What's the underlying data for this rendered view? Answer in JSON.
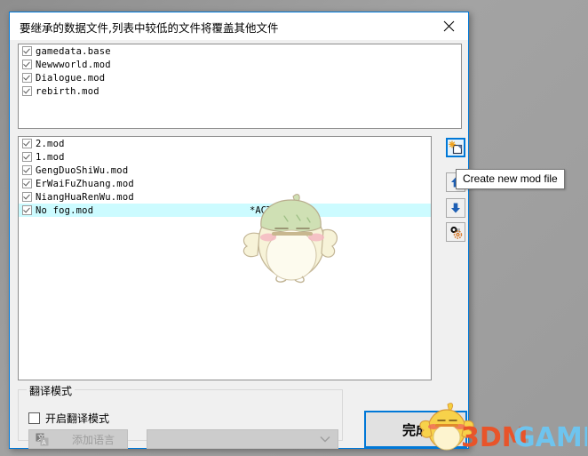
{
  "window": {
    "title": "要继承的数据文件,列表中较低的文件将覆盖其他文件",
    "close_label": "×",
    "close_icon": "close-icon"
  },
  "inherit_list": {
    "items": [
      {
        "label": "gamedata.base",
        "checked": true
      },
      {
        "label": "Newwworld.mod",
        "checked": true
      },
      {
        "label": "Dialogue.mod",
        "checked": true
      },
      {
        "label": "rebirth.mod",
        "checked": true
      }
    ]
  },
  "mod_list": {
    "active_tag": "*ACTIVE*",
    "items": [
      {
        "label": "2.mod",
        "checked": true,
        "active": false
      },
      {
        "label": "1.mod",
        "checked": true,
        "active": false
      },
      {
        "label": "GengDuoShiWu.mod",
        "checked": true,
        "active": false
      },
      {
        "label": "ErWaiFuZhuang.mod",
        "checked": true,
        "active": false
      },
      {
        "label": "NiangHuaRenWu.mod",
        "checked": true,
        "active": false
      },
      {
        "label": "No fog.mod",
        "checked": true,
        "active": true
      }
    ]
  },
  "toolbar": {
    "new_mod_icon": "new-file-icon",
    "move_up_icon": "arrow-up-icon",
    "move_down_icon": "arrow-down-icon",
    "settings_icon": "gear-icon"
  },
  "tooltip": {
    "text": "Create new mod file"
  },
  "translation_group": {
    "legend": "翻译模式",
    "checkbox_label": "开启翻译模式",
    "checkbox_checked": false,
    "add_language_label": "添加语言",
    "add_language_icon": "language-icon",
    "add_language_enabled": false,
    "language_select_value": "",
    "language_select_enabled": false,
    "dropdown_icon": "chevron-down-icon"
  },
  "footer": {
    "finish_label": "完成"
  },
  "watermark": {
    "part1": "3DM",
    "part2": "GAME"
  },
  "colors": {
    "accent": "#0078d7",
    "active_row": "#ccfbff",
    "window_bg": "#f0f0f0",
    "watermark_orange": "#e8542a",
    "watermark_blue": "#6ec4ee"
  }
}
